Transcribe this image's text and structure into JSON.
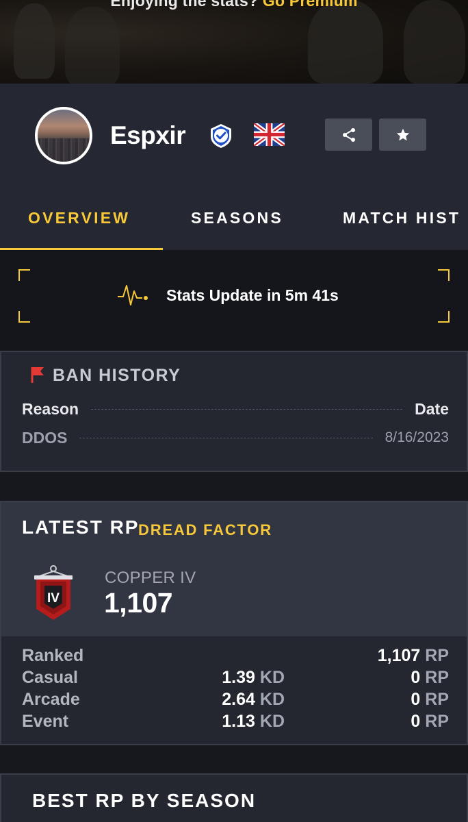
{
  "banner": {
    "text": "Enjoying the stats?",
    "cta": "Go Premium"
  },
  "profile": {
    "username": "Espxir",
    "verified_icon": "verified-shield-icon",
    "flag": "uk-flag"
  },
  "actions": {
    "share_icon": "share-icon",
    "favorite_icon": "star-icon"
  },
  "tabs": [
    {
      "label": "OVERVIEW",
      "active": true
    },
    {
      "label": "SEASONS",
      "active": false
    },
    {
      "label": "MATCH HIST",
      "active": false
    }
  ],
  "stats_update": {
    "icon": "pulse-icon",
    "text": "Stats Update in 5m 41s"
  },
  "ban_history": {
    "title": "BAN HISTORY",
    "icon": "red-flag-icon",
    "headers": {
      "reason": "Reason",
      "date": "Date"
    },
    "rows": [
      {
        "reason": "DDOS",
        "date": "8/16/2023"
      }
    ]
  },
  "latest_rp": {
    "title": "LATEST RP",
    "season": "DREAD FACTOR",
    "rank_icon": "copper-iv-rank-icon",
    "rank_numeral": "IV",
    "rank_name": "COPPER IV",
    "rp": "1,107",
    "modes": [
      {
        "name": "Ranked",
        "kd": "",
        "kd_unit": "",
        "rp": "1,107",
        "rp_unit": "RP"
      },
      {
        "name": "Casual",
        "kd": "1.39",
        "kd_unit": "KD",
        "rp": "0",
        "rp_unit": "RP"
      },
      {
        "name": "Arcade",
        "kd": "2.64",
        "kd_unit": "KD",
        "rp": "0",
        "rp_unit": "RP"
      },
      {
        "name": "Event",
        "kd": "1.13",
        "kd_unit": "KD",
        "rp": "0",
        "rp_unit": "RP"
      }
    ]
  },
  "best_rp": {
    "title": "BEST RP BY SEASON"
  },
  "colors": {
    "accent": "#f7c83a",
    "background": "#16181e",
    "card": "#24272f",
    "header": "#252832",
    "ban_flag": "#e53935",
    "rank_red": "#b71c1c"
  }
}
